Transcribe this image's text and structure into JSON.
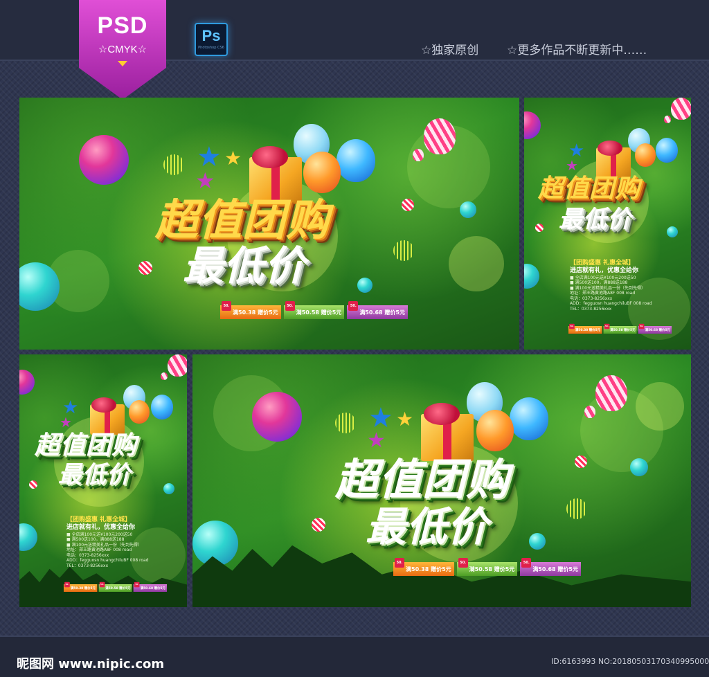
{
  "header": {
    "badge_title": "PSD",
    "badge_subtitle": "☆CMYK☆",
    "app_icon_label": "Ps",
    "app_icon_sublabel": "Photoshop CS6",
    "notes": [
      "☆独家原创",
      "☆更多作品不断更新中……"
    ]
  },
  "poster": {
    "title_line1": "超值团购",
    "title_line2": "最低价",
    "tags": [
      {
        "corner": "50.",
        "label": "满50.38 赠价5元"
      },
      {
        "corner": "50.",
        "label": "满50.58 赠价5元"
      },
      {
        "corner": "50.",
        "label": "满50.68 赠价5元"
      }
    ],
    "copy_head": "【团购盛惠  礼惠全城】",
    "copy_sub": "进店就有礼，优惠全给你",
    "copy_lines": [
      "■ 全店满100元送¥100元200送50",
      "■ 满500送100，满888送188",
      "■ 满100元送精美礼品一份（先到先得）",
      "地址：郑王路黄池路A8F 008 road",
      "电话：0373-8256xxx",
      "ADD：fegguosn huangchiluBF 008 road",
      "TEL：0373-8256xxx"
    ]
  },
  "colors": {
    "topbar": "#262c3f",
    "stage": "#2f3650",
    "badge": "#c23fbf",
    "poster_green": "#2b8a24",
    "title_gold": "#ffd94a"
  },
  "footer": {
    "site": "昵图网 www.nipic.com",
    "image_id": "ID:6163993 NO:20180503170340995000"
  }
}
